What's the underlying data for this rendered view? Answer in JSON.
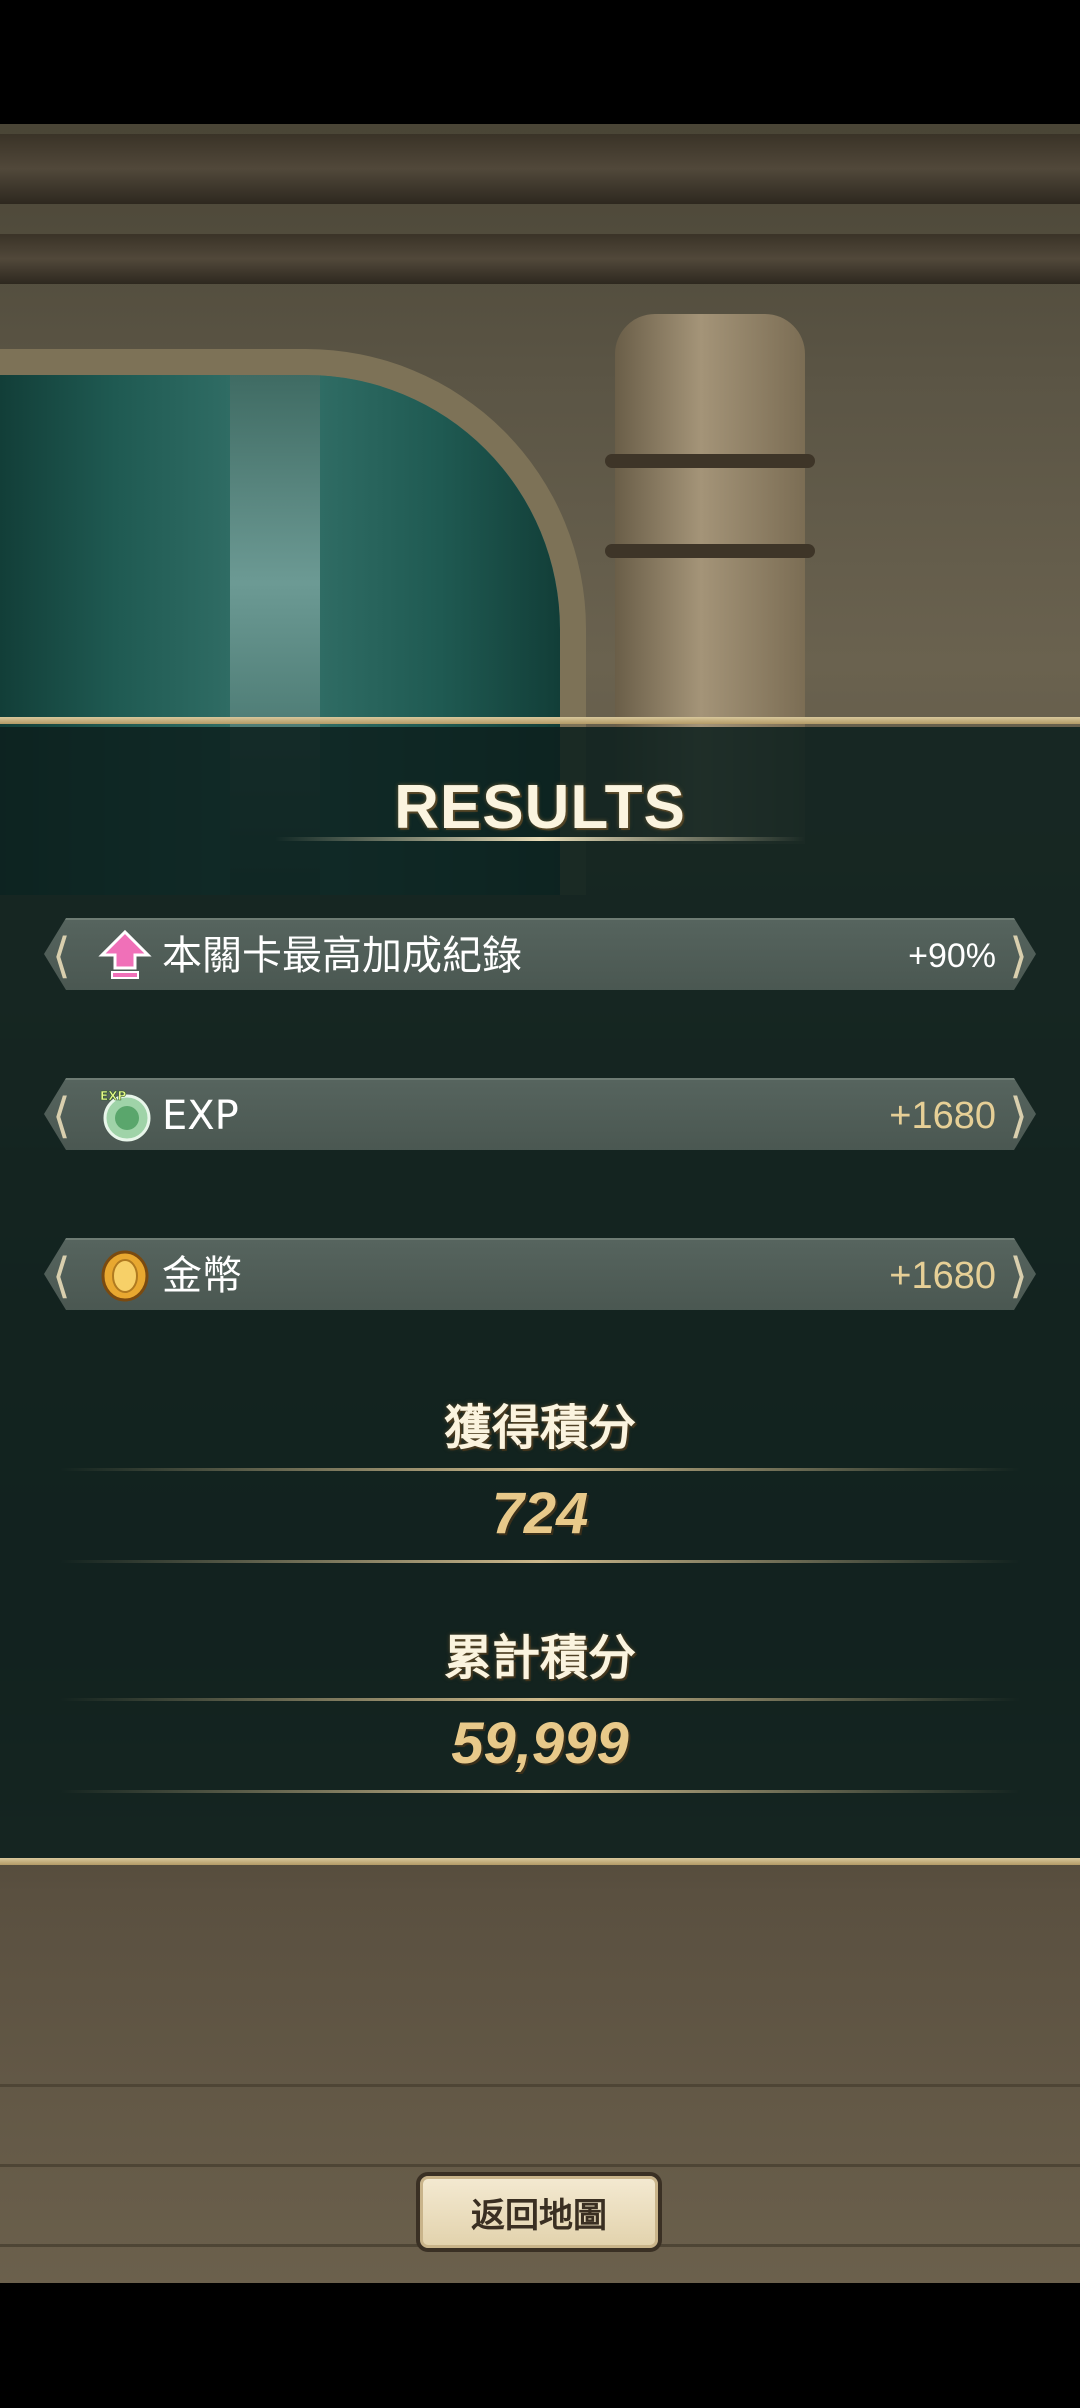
{
  "results": {
    "title": "RESULTS",
    "rows": [
      {
        "icon": "pink-up-arrow-icon",
        "label": "本關卡最高加成紀錄",
        "value": "+90%"
      },
      {
        "icon": "exp-orb-icon",
        "icon_text": "EXP",
        "label": "EXP",
        "value": "+1680"
      },
      {
        "icon": "gold-coin-icon",
        "label": "金幣",
        "value": "+1680"
      }
    ],
    "earned_points": {
      "label": "獲得積分",
      "value": "724"
    },
    "total_points": {
      "label": "累計積分",
      "value": "59,999"
    }
  },
  "return_button": {
    "label": "返回地圖"
  },
  "colors": {
    "panel": "#0d201e",
    "gold_text": "#e8c98a",
    "gold_line": "#d8c79b",
    "row_bg": "#4f5c56"
  }
}
